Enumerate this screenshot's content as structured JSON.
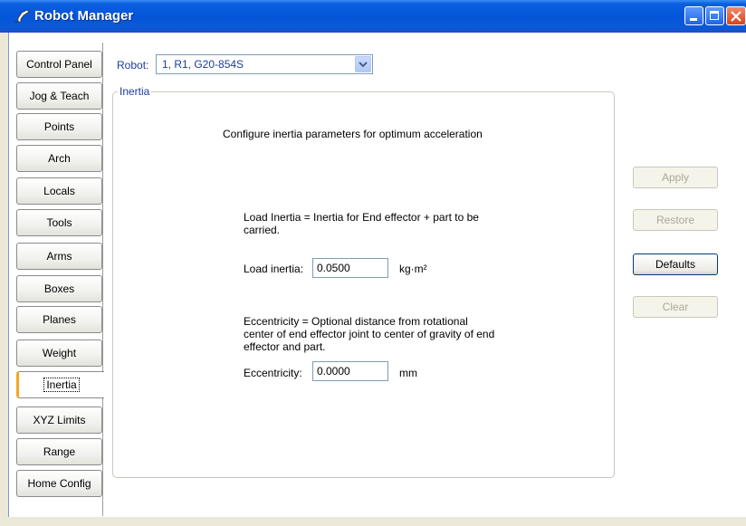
{
  "window": {
    "title": "Robot Manager",
    "icon": "robot-arm-icon"
  },
  "tabs": [
    {
      "label": "Control Panel",
      "active": false
    },
    {
      "label": "Jog & Teach",
      "active": false
    },
    {
      "label": "Points",
      "active": false
    },
    {
      "label": "Arch",
      "active": false
    },
    {
      "label": "Locals",
      "active": false
    },
    {
      "label": "Tools",
      "active": false
    },
    {
      "label": "Arms",
      "active": false
    },
    {
      "label": "Boxes",
      "active": false
    },
    {
      "label": "Planes",
      "active": false
    },
    {
      "label": "Weight",
      "active": false
    },
    {
      "label": "Inertia",
      "active": true
    },
    {
      "label": "XYZ Limits",
      "active": false
    },
    {
      "label": "Range",
      "active": false
    },
    {
      "label": "Home Config",
      "active": false
    }
  ],
  "robot": {
    "label": "Robot:",
    "selected": "1, R1, G20-854S"
  },
  "inertia": {
    "group_title": "Inertia",
    "intro": "Configure inertia parameters for optimum acceleration",
    "load_desc": "Load Inertia = Inertia for End effector + part to be carried.",
    "load_label": "Load inertia:",
    "load_value": "0.0500",
    "load_unit": "kg·m²",
    "ecc_desc": "Eccentricity = Optional distance from rotational center of end effector joint to center of gravity of end effector and part.",
    "ecc_label": "Eccentricity:",
    "ecc_value": "0.0000",
    "ecc_unit": "mm"
  },
  "buttons": {
    "apply": "Apply",
    "restore": "Restore",
    "defaults": "Defaults",
    "clear": "Clear"
  }
}
